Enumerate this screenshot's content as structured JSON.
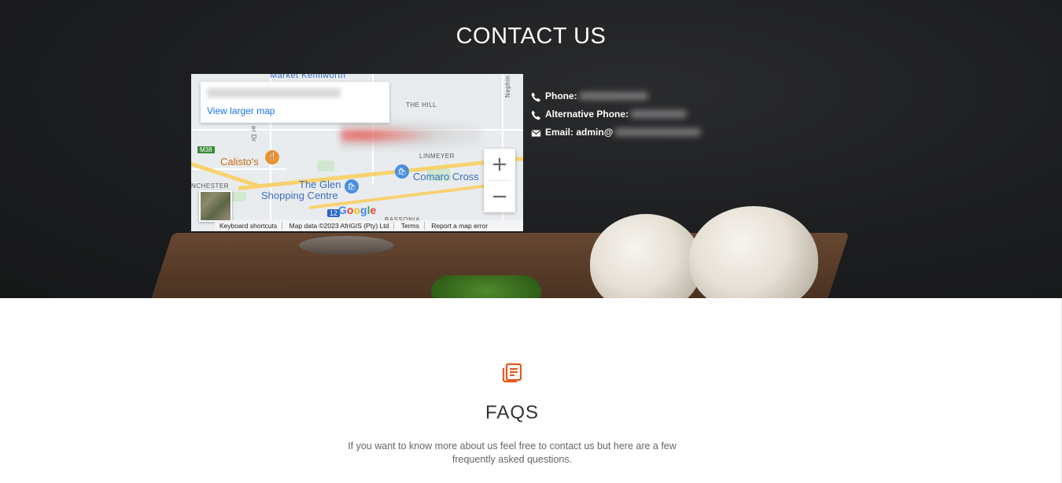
{
  "contact": {
    "title": "CONTACT US",
    "items": [
      {
        "icon": "phone-icon",
        "label": "Phone:"
      },
      {
        "icon": "phone-icon",
        "label": "Alternative Phone:"
      },
      {
        "icon": "envelope-icon",
        "label": "Email: admin@"
      }
    ]
  },
  "map": {
    "infobox_link": "View larger map",
    "labels": {
      "market": "Market Kenilworth",
      "the_hill": "THE HILL",
      "nephin": "Nephin Rd",
      "m38": "M38",
      "calistos": "Calisto's",
      "linmeyer": "LINMEYER",
      "comaro": "Comaro Cross",
      "glen1": "The Glen",
      "glen2": "Shopping Centre",
      "winchester": "NCHESTER",
      "bassonia": "BASSONIA",
      "route12": "12",
      "st": "St",
      "dr": "er Dr"
    },
    "zoom_in": "+",
    "zoom_out": "−",
    "brand": "Google",
    "footer": {
      "shortcuts": "Keyboard shortcuts",
      "data": "Map data ©2023 AfriGIS (Pty) Ltd",
      "terms": "Terms",
      "report": "Report a map error"
    }
  },
  "faq": {
    "icon": "articles-icon",
    "title": "FAQS",
    "description_line1": "If you want to know more about us feel free to contact us but here are a few",
    "description_line2": "frequently asked questions."
  },
  "colors": {
    "accent": "#e8591d",
    "hero_bg": "#1c1d1f",
    "link": "#1a73e8"
  }
}
